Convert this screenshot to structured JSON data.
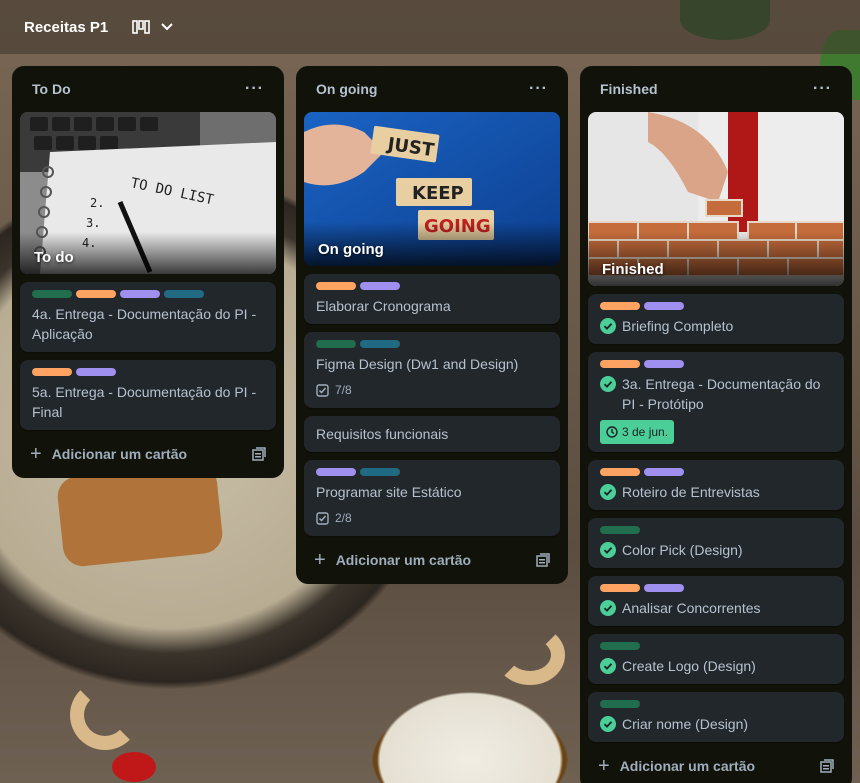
{
  "board": {
    "title": "Receitas P1"
  },
  "lists": [
    {
      "title": "To Do",
      "cover_label": "To do",
      "cards": [
        {
          "title": "4a. Entrega - Documentação do PI - Aplicação"
        },
        {
          "title": "5a. Entrega - Documentação do PI - Final"
        }
      ],
      "add_label": "Adicionar um cartão"
    },
    {
      "title": "On going",
      "cover_label": "On going",
      "cover_words": [
        "JUST",
        "KEEP",
        "GOING"
      ],
      "cards": [
        {
          "title": "Elaborar Cronograma"
        },
        {
          "title": "Figma Design (Dw1 and Design)",
          "checklist": "7/8"
        },
        {
          "title": "Requisitos funcionais"
        },
        {
          "title": "Programar site Estático",
          "checklist": "2/8"
        }
      ],
      "add_label": "Adicionar um cartão"
    },
    {
      "title": "Finished",
      "cover_label": "Finished",
      "cards": [
        {
          "title": "Briefing Completo"
        },
        {
          "title": "3a. Entrega - Documentação do PI - Protótipo",
          "due": "3 de jun."
        },
        {
          "title": "Roteiro de Entrevistas"
        },
        {
          "title": "Color Pick (Design)"
        },
        {
          "title": "Analisar Concorrentes"
        },
        {
          "title": "Create Logo (Design)"
        },
        {
          "title": "Criar nome (Design)"
        }
      ],
      "add_label": "Adicionar um cartão"
    }
  ],
  "colors": {
    "label_green": "#216e4e",
    "label_orange": "#fea362",
    "label_purple": "#9f8fef",
    "label_teal": "#206a83",
    "complete_green": "#4bce97"
  }
}
